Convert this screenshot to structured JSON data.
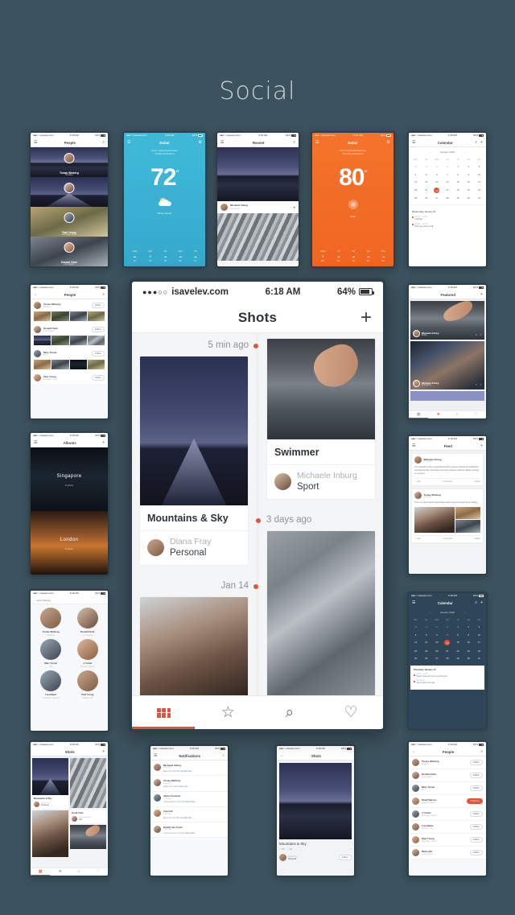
{
  "page": {
    "title": "Social",
    "background": "#3c525e"
  },
  "accent": "#e8503a",
  "main_phone": {
    "status": {
      "carrier": "isavelev.com",
      "signal": "●●●○○",
      "time": "6:18 AM",
      "battery": "64%"
    },
    "nav": {
      "title": "Shots",
      "add_label": "+"
    },
    "timeline": [
      {
        "label": "5 min ago",
        "side": "left"
      },
      {
        "label": "3 days ago",
        "side": "right"
      },
      {
        "label": "Jan 14",
        "side": "left"
      }
    ],
    "cards": [
      {
        "title": "Mountains & Sky",
        "author": "Diana Fray",
        "role": "Personal",
        "photo": "night-mountain"
      },
      {
        "title": "Swimmer",
        "author": "Michaele Inburg",
        "role": "Sport",
        "photo": "swimmer"
      },
      {
        "title": "",
        "author": "",
        "role": "",
        "photo": "city-aerial"
      },
      {
        "title": "",
        "author": "",
        "role": "",
        "photo": "family"
      }
    ],
    "tabs": [
      {
        "name": "grid",
        "icon": "grid-icon",
        "active": true
      },
      {
        "name": "featured",
        "icon": "star-icon",
        "active": false
      },
      {
        "name": "search",
        "icon": "search-icon",
        "active": false
      },
      {
        "name": "likes",
        "icon": "heart-icon",
        "active": false
      }
    ]
  },
  "status_common": {
    "carrier": "isavelev.com",
    "time": "6:18 AM",
    "battery": "64%"
  },
  "phones": {
    "people_cover": {
      "nav_title": "People",
      "people": [
        {
          "name": "Tomas Winberg",
          "sub": "Brooklyn"
        },
        {
          "name": "Ronald Clark",
          "sub": "Los Angeles"
        },
        {
          "name": "Paul Young",
          "sub": "Woodway, Texas"
        },
        {
          "name": "Ronald Clark",
          "sub": "Los Angeles"
        }
      ]
    },
    "weather_blue": {
      "nav_title": "Dubai",
      "location": "Dubai, United Arab Emirates",
      "date": "Sunday, December 6",
      "temp": "72",
      "unit": "°",
      "condition": "Partly Cloudy",
      "forecast": [
        {
          "day": "Today",
          "hi": "72°",
          "lo": "59°"
        },
        {
          "day": "Mon",
          "hi": "74°",
          "lo": "60°"
        },
        {
          "day": "Tue",
          "hi": "75°",
          "lo": "61°"
        },
        {
          "day": "Wed",
          "hi": "69°",
          "lo": "57°"
        },
        {
          "day": "Thu",
          "hi": "71°",
          "lo": "58°"
        }
      ]
    },
    "weather_orange": {
      "nav_title": "Dubai",
      "location": "Dubai, United Arab Emirates",
      "date": "Thursday, December 3",
      "temp": "80",
      "unit": "°",
      "condition": "Clear",
      "forecast": [
        {
          "day": "Today",
          "hi": "80°",
          "lo": "66°"
        },
        {
          "day": "Fri",
          "hi": "81°",
          "lo": "67°"
        },
        {
          "day": "Sat",
          "hi": "79°",
          "lo": "65°"
        },
        {
          "day": "Sun",
          "hi": "82°",
          "lo": "68°"
        },
        {
          "day": "Mon",
          "hi": "80°",
          "lo": "66°"
        }
      ]
    },
    "recent": {
      "nav_title": "Recent",
      "post_author": "Michaele Inburg",
      "post_sub": "Somewhere"
    },
    "calendar_light": {
      "nav_title": "Calendar",
      "month": "January 2016",
      "dow": [
        "Mon",
        "Tue",
        "Wed",
        "Thu",
        "Fri",
        "Sat",
        "Sun"
      ],
      "days": [
        28,
        29,
        30,
        31,
        1,
        2,
        3,
        4,
        5,
        6,
        7,
        8,
        9,
        10,
        11,
        12,
        13,
        14,
        15,
        16,
        17,
        18,
        19,
        20,
        21,
        22,
        23,
        24,
        25,
        26,
        27,
        28,
        29,
        30,
        31
      ],
      "selected": 20,
      "event_day": "Wednesday, January 20",
      "events": [
        {
          "time": "11:00 – 14:00",
          "title": "Call Dan"
        },
        {
          "time": "18:00 – 19:00",
          "title": "Pick up a shop stuff"
        }
      ]
    },
    "calendar_dark": {
      "nav_title": "Calendar",
      "month": "January 2016",
      "dow": [
        "Mon",
        "Tue",
        "Wed",
        "Thu",
        "Fri",
        "Sat",
        "Sun"
      ],
      "days": [
        28,
        29,
        30,
        31,
        1,
        2,
        3,
        4,
        5,
        6,
        7,
        8,
        9,
        10,
        11,
        12,
        13,
        14,
        15,
        16,
        17,
        18,
        19,
        20,
        21,
        22,
        23,
        24,
        25,
        26,
        27,
        28,
        29,
        30,
        31
      ],
      "selected": 14,
      "event_day": "Thursday, January 14",
      "events": [
        {
          "time": "11:00 – 14:00",
          "title": "Happy meal with some good friends"
        },
        {
          "time": "Producing",
          "title": "Just another nice day"
        }
      ]
    },
    "people_list": {
      "nav_title": "People",
      "rows": [
        {
          "name": "Tomas Winberg",
          "sub": "Brooklyn",
          "action": "Follow"
        },
        {
          "name": "Ronald Clark",
          "sub": "Los Angeles",
          "action": "Follow"
        },
        {
          "name": "Mary Turner",
          "sub": "NYC",
          "action": "Follow"
        },
        {
          "name": "Paul Young",
          "sub": "Woodway, Texas",
          "action": "Follow"
        }
      ]
    },
    "featured": {
      "nav_title": "Featured",
      "items": [
        {
          "author": "Michaele Inburg",
          "sub": "Dublin"
        },
        {
          "author": "Michaele Inburg",
          "sub": "Somewhere"
        }
      ]
    },
    "albums": {
      "nav_title": "Albums",
      "items": [
        {
          "title": "Singapore",
          "sub": "24 photos"
        },
        {
          "title": "London",
          "sub": "58 photos"
        }
      ]
    },
    "feed": {
      "nav_title": "Feed",
      "posts": [
        {
          "author": "Michaele Inburg",
          "time": "5 min ago",
          "text": "The interaction of the cooperation and the customer pushes the institutional corporate identity. Advertising community induces a banner display, working on a project.",
          "actions": [
            "Like",
            "Comment",
            "Share"
          ]
        },
        {
          "author": "Tomas Winberg",
          "time": "2 hrs ago",
          "text": "Thus, it is clear that the advertising medium speeds typical banner display.",
          "actions": [
            "Like",
            "Comment",
            "Share"
          ]
        }
      ]
    },
    "people_search": {
      "search_placeholder": "Enter Naming",
      "people": [
        {
          "name": "Tomas Winberg",
          "sub": "Brooklyn"
        },
        {
          "name": "Ronald Clark",
          "sub": "Los Angeles"
        },
        {
          "name": "Mary Turner",
          "sub": "NYC"
        },
        {
          "name": "J. Carter",
          "sub": "Roanoke, Virginia"
        },
        {
          "name": "Lisa Baker",
          "sub": "Stockholm, Sweden"
        },
        {
          "name": "Paul Young",
          "sub": "Fairfield, CA"
        }
      ]
    },
    "shots_grid": {
      "nav_title": "Shots",
      "cards": [
        {
          "title": "Mountains & Sky",
          "author": "Diana Fray",
          "role": "Personal"
        },
        {
          "title": "Great View",
          "author": "Michaele Inburg",
          "role": "City"
        }
      ]
    },
    "notifications": {
      "nav_title": "Notifications",
      "rows": [
        {
          "name": "Michaele Inburg",
          "time": "5 min ago",
          "action": "likes your post",
          "link": "You can add other..."
        },
        {
          "name": "Tomas Winberg",
          "time": "2 hrs ago",
          "action": "shared your photo",
          "link": "View now"
        },
        {
          "name": "Janie Customer",
          "time": "3 hrs ago",
          "action": "commented on your post",
          "link": "Close Filter..."
        },
        {
          "name": "Cap Indi",
          "time": "6 hrs ago",
          "action": "likes your post",
          "link": "You can add other..."
        },
        {
          "name": "Rudolf van Cruze",
          "time": "1 day ago",
          "action": "commented on your post",
          "link": "Close Filter..."
        }
      ]
    },
    "shot_detail": {
      "nav_title": "Shots",
      "title": "Mountains & Sky",
      "likes": "32",
      "comments": "44",
      "author": "Diana Fray",
      "role": "Personal",
      "action": "Follow"
    },
    "people_follow": {
      "nav_title": "People",
      "rows": [
        {
          "name": "Tomas Winberg",
          "sub": "Brooklyn",
          "action": "Follow",
          "following": false
        },
        {
          "name": "Ronald Clark",
          "sub": "Los Angeles",
          "action": "Follow",
          "following": false
        },
        {
          "name": "Mary Turner",
          "sub": "NYC",
          "action": "Follow",
          "following": false
        },
        {
          "name": "David Nelson",
          "sub": "Warsaw, Poland",
          "action": "Following",
          "following": true
        },
        {
          "name": "J. Carter",
          "sub": "Roanoke, Virginia",
          "action": "Follow",
          "following": false
        },
        {
          "name": "Lisa Baker",
          "sub": "Richard, OR",
          "action": "Follow",
          "following": false
        },
        {
          "name": "Paul Young",
          "sub": "Woodway, Texas",
          "action": "Follow",
          "following": false
        },
        {
          "name": "Mark Hall",
          "sub": "Austin, Texas",
          "action": "Follow",
          "following": false
        }
      ]
    }
  }
}
